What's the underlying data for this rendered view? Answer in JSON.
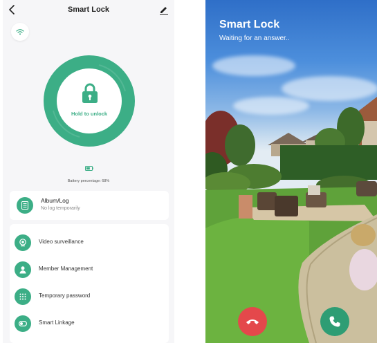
{
  "left": {
    "title": "Smart Lock",
    "lock": {
      "label": "Hold to unlock"
    },
    "battery": {
      "text": "Battery percentage: 68%",
      "level": 0.68
    },
    "album": {
      "title": "Album/Log",
      "subtitle": "No log temporarily"
    },
    "menu": [
      {
        "label": "Video surveillance",
        "icon": "camera-icon"
      },
      {
        "label": "Member Management",
        "icon": "person-icon"
      },
      {
        "label": "Temporary password",
        "icon": "keypad-icon"
      },
      {
        "label": "Smart Linkage",
        "icon": "toggle-icon"
      }
    ]
  },
  "right": {
    "title": "Smart Lock",
    "status": "Waiting for an answer.."
  },
  "colors": {
    "accent": "#3cae86",
    "hangup": "#e4484b",
    "answer": "#2e9d74"
  }
}
